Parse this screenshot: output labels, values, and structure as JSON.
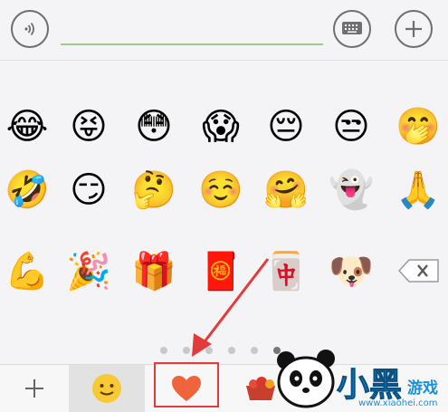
{
  "emoji_rows": [
    [
      "😂",
      "😝",
      "😳",
      "😱",
      "😔",
      "😒",
      "🤭"
    ],
    [
      "🤣",
      "😏",
      "🤔",
      "☺️",
      "🤗",
      "👻",
      "🙏"
    ],
    [
      "💪",
      "🎉",
      "🎁",
      "🧧",
      "🀄",
      "🐶"
    ]
  ],
  "toolbar": {
    "add_glyph": "+",
    "smiley_glyph": "🙂",
    "heart_glyph": "❤️",
    "package_glyph": "🧺"
  },
  "pagination": {
    "total": 6,
    "active_index": 5
  },
  "watermark": {
    "title": "小黑",
    "subtitle": "游戏",
    "url": "www.xiaohei.com"
  },
  "colors": {
    "highlight": "#e33b3b",
    "arrow": "#e33b3b",
    "input_line": "#9bc98e"
  },
  "icons": {
    "voice": "voice-icon",
    "keyboard": "keyboard-icon",
    "plus": "plus-icon",
    "backspace": "backspace-icon"
  }
}
